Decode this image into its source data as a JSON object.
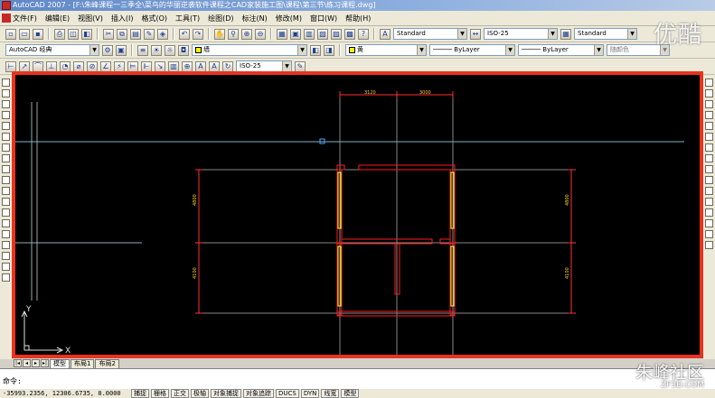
{
  "window": {
    "title": "AutoCAD 2007 - [F:\\朱峰课程一三季全\\菜鸟的华丽逆袭软件课程之CAD家装施工图\\课程\\第三节\\练习课程.dwg]"
  },
  "menu": [
    "文件(F)",
    "编辑(E)",
    "视图(V)",
    "插入(I)",
    "格式(O)",
    "工具(T)",
    "绘图(D)",
    "标注(N)",
    "修改(M)",
    "窗口(W)",
    "帮助(H)"
  ],
  "toolbar": {
    "text_style": "Standard",
    "dim_style": "ISO-25",
    "table_style": "Standard",
    "workspace": "AutoCAD 经典",
    "layer_name": "墙",
    "color": "黄",
    "linetype": "ByLayer",
    "lineweight": "ByLayer",
    "plot_style": "随颜色",
    "dim_style_2": "ISO-25"
  },
  "drawing": {
    "dim_top_left": "3120",
    "dim_top_right": "3000",
    "dim_left_upper": "4800",
    "dim_left_lower": "4100",
    "dim_right_upper": "4800",
    "dim_right_lower": "4100",
    "ucs_x": "X",
    "ucs_y": "Y"
  },
  "tabs": {
    "model": "模型",
    "layout1": "布局1",
    "layout2": "布局2"
  },
  "command": {
    "prompt": "命令:"
  },
  "status": {
    "coords": "-35993.2356, 12306.6735, 0.0000",
    "buttons": [
      "捕捉",
      "栅格",
      "正交",
      "极轴",
      "对象捕捉",
      "对象追踪",
      "DUCS",
      "DYN",
      "线宽",
      "模型"
    ]
  },
  "watermark": {
    "top": "优酷",
    "bottom": "朱峰社区",
    "bottom_url": "ZF3D.COM"
  },
  "colors": {
    "viewport_border": "#e8331f",
    "wall": "#ff1a1a",
    "window": "#ffff33",
    "dimension": "#ff3030"
  }
}
